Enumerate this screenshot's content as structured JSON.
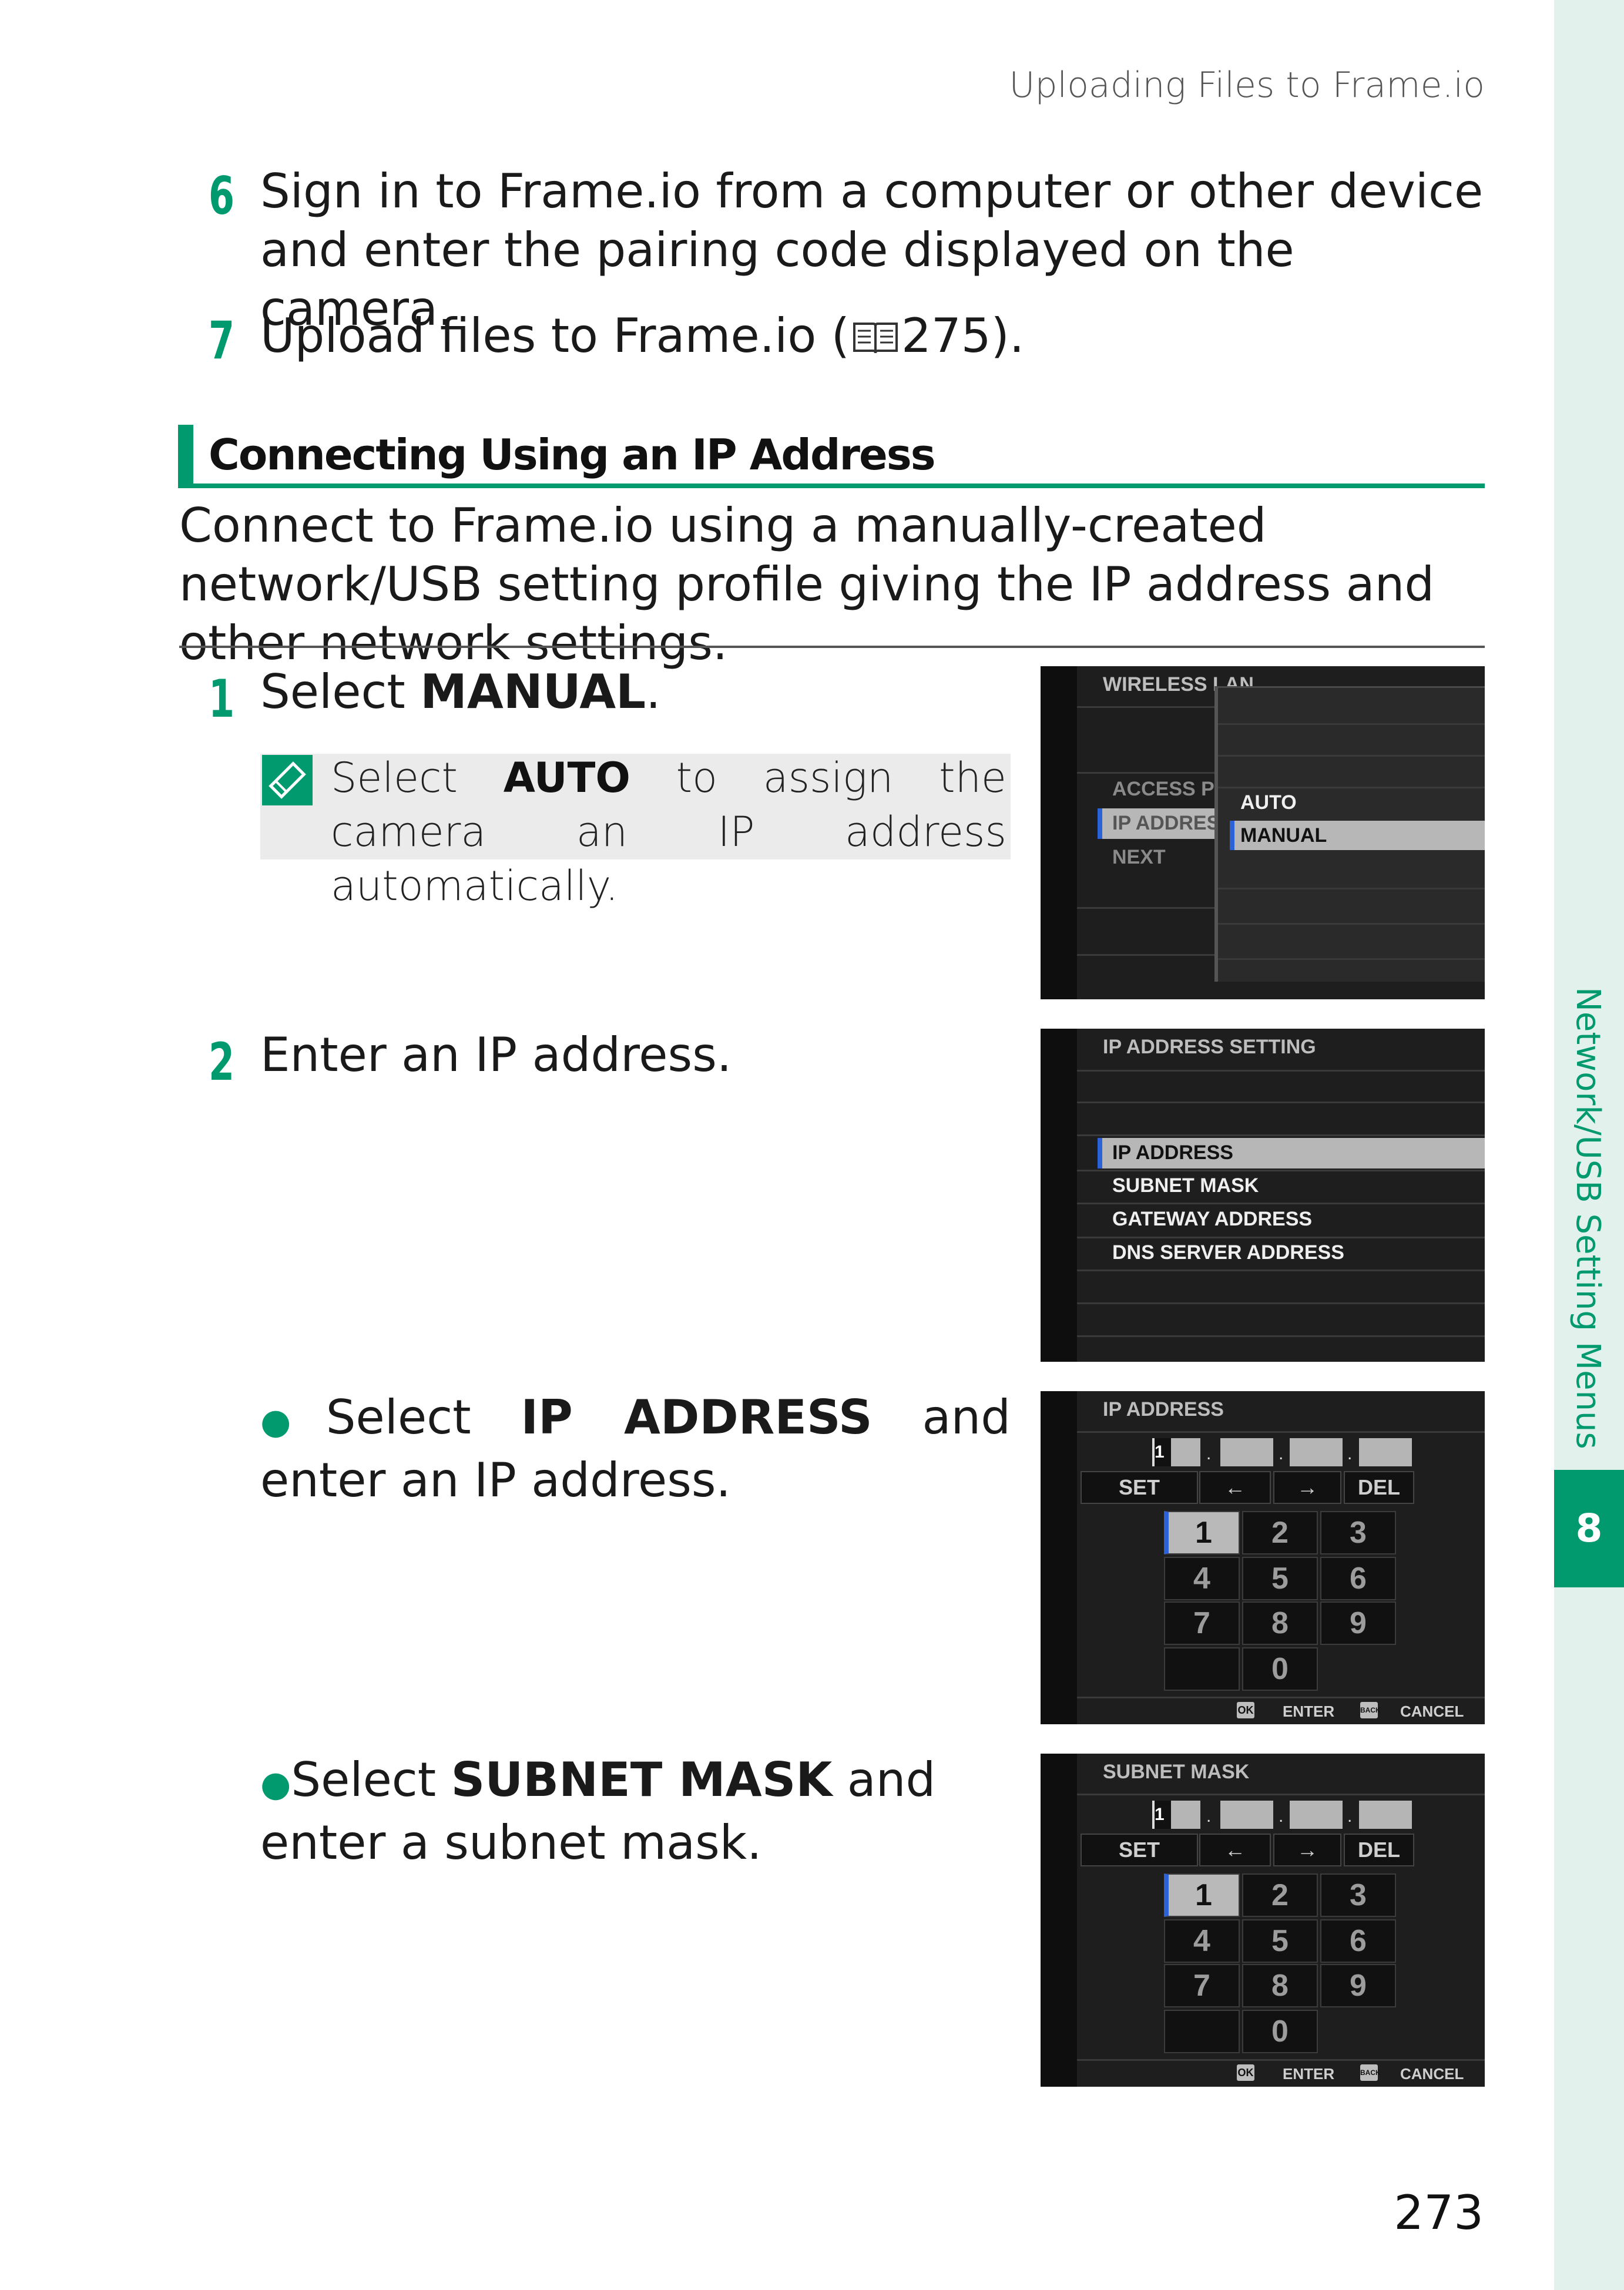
{
  "header": {
    "title": "Uploading Files to Frame.io"
  },
  "steps_top": [
    {
      "num": "6",
      "text": "Sign in to Frame.io from a computer or other device and enter the pairing code displayed on the camera."
    },
    {
      "num": "7",
      "text": "Upload files to Frame.io (",
      "ref": "275",
      "text_end": ")."
    }
  ],
  "section": {
    "title": "Connecting Using an IP Address",
    "intro": "Connect to Frame.io using a manually-created network/USB setting profile giving the IP address and other network settings."
  },
  "step1": {
    "num": "1",
    "prefix": "Select ",
    "bold": "MANUAL",
    "suffix": "."
  },
  "note": {
    "prefix": "Select ",
    "bold": "AUTO",
    "suffix": " to assign the camera an IP address automatically."
  },
  "step2": {
    "num": "2",
    "text": "Enter an IP address."
  },
  "bullet1": {
    "prefix": "Select ",
    "bold": "IP ADDRESS",
    "suffix": " and enter an IP address."
  },
  "bullet2": {
    "prefix": "Select ",
    "bold": "SUBNET MASK",
    "suffix": " and enter a subnet mask."
  },
  "screen1": {
    "title": "WIRELESS LAN",
    "items": [
      "ACCESS POINT SETTING",
      "IP ADDRESS SETTING",
      "NEXT"
    ],
    "popup": [
      "AUTO",
      "MANUAL"
    ]
  },
  "screen2": {
    "title": "IP ADDRESS SETTING",
    "items": [
      "IP ADDRESS",
      "SUBNET MASK",
      "GATEWAY ADDRESS",
      "DNS SERVER ADDRESS"
    ]
  },
  "keypad": {
    "set": "SET",
    "del": "DEL",
    "left": "←",
    "right": "→",
    "keys": [
      "1",
      "2",
      "3",
      "4",
      "5",
      "6",
      "7",
      "8",
      "9",
      "0"
    ],
    "ok": "OK",
    "enter": "ENTER",
    "back": "BACK",
    "cancel": "CANCEL",
    "cursor": "1",
    "dot": "."
  },
  "screen3": {
    "title": "IP ADDRESS"
  },
  "screen4": {
    "title": "SUBNET MASK"
  },
  "side": {
    "chapter_title": "Network/USB Setting Menus",
    "chapter_num": "8"
  },
  "page": {
    "number": "273"
  },
  "colors": {
    "accent": "#009a6e",
    "highlight_blue": "#2b62d8"
  }
}
